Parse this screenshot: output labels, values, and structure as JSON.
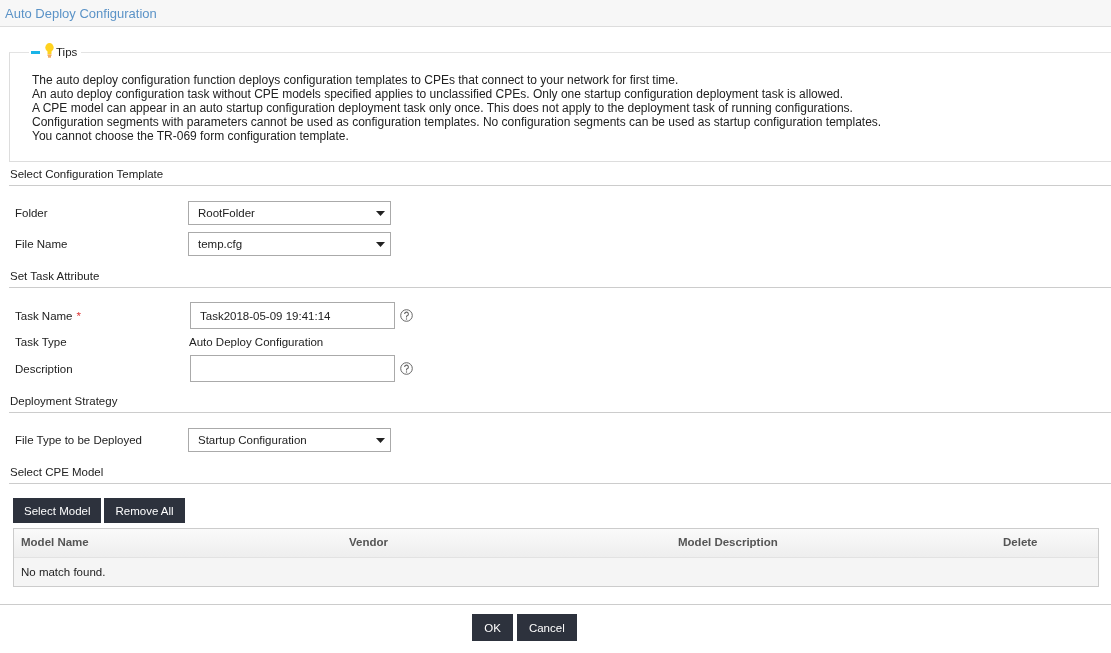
{
  "header": {
    "title": "Auto Deploy Configuration"
  },
  "tips": {
    "title": "Tips",
    "expanded": true,
    "lines": [
      "The auto deploy configuration function deploys configuration templates to CPEs that connect to your network for first time.",
      "An auto deploy configuration task without CPE models specified applies to unclassified CPEs. Only one startup configuration deployment task is allowed.",
      "A CPE model can appear in an auto startup configuration deployment task only once. This does not apply to the deployment task of running configurations.",
      "Configuration segments with parameters cannot be used as configuration templates. No configuration segments can be used as startup configuration templates.",
      "You cannot choose the TR-069 form configuration template."
    ]
  },
  "sections": [
    {
      "title": "Select Configuration Template",
      "fields": [
        {
          "kind": "select",
          "label": "Folder",
          "value": "RootFolder",
          "help": false
        },
        {
          "kind": "select",
          "label": "File Name",
          "value": "temp.cfg",
          "help": false
        }
      ]
    },
    {
      "title": "Set Task Attribute",
      "fields": [
        {
          "kind": "input",
          "label": "Task Name",
          "required_mark": "*",
          "value": "Task2018-05-09 19:41:14",
          "help": true
        },
        {
          "kind": "text",
          "label": "Task Type",
          "value": "Auto Deploy Configuration",
          "help": false
        },
        {
          "kind": "input",
          "label": "Description",
          "help": true
        }
      ]
    },
    {
      "title": "Deployment Strategy",
      "fields": [
        {
          "kind": "select",
          "label": "File Type to be Deployed",
          "value": "Startup Configuration",
          "help": false
        }
      ]
    },
    {
      "title": "Select CPE Model"
    }
  ],
  "model_buttons": [
    "Select Model",
    "Remove All"
  ],
  "table": {
    "columns": [
      "Model Name",
      "Vendor",
      "Model Description",
      "Delete"
    ],
    "empty_text": "No match found."
  },
  "footer_buttons": [
    "OK",
    "Cancel"
  ]
}
